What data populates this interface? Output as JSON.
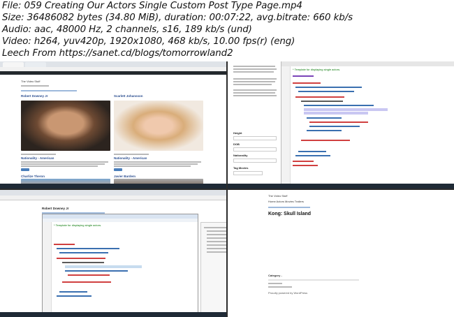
{
  "header": {
    "lines": [
      "File: 059 Creating Our Actors Single Custom Post Type Page.mp4",
      "Size: 36486082 bytes (34.80 MiB), duration: 00:07:22, avg.bitrate: 660 kb/s",
      "Audio: aac, 48000 Hz, 2 channels, s16, 189 kb/s (und)",
      "Video: h264, yuv420p, 1920x1080, 468 kb/s, 10.00 fps(r) (eng)",
      "Leech From https://sanet.cd/blogs/tomorrowland2"
    ]
  },
  "thumb1": {
    "actors": [
      "Robert Downey Jr",
      "Scarlett Johansson",
      "Charlize Theron",
      "Javier Bardem"
    ],
    "field_label": "Nationality - American"
  },
  "thumb2": {
    "labels": [
      "Height",
      "DOB",
      "Nationality",
      "Tag Movies"
    ],
    "code_comment": "* Template for displaying single actors."
  },
  "thumb3": {
    "heading": "Robert Downey Jr",
    "code_comment": "* Template for displaying single actors."
  },
  "thumb4": {
    "site_title": "The Video Stuff",
    "nav": "Home  Actors  Movies  Trailers",
    "post_title": "Kong: Skull Island",
    "category_label": "Category -",
    "footer": "Proudly powered by WordPress"
  },
  "colors": {
    "editor_highlight": "#c9c7f2",
    "link_blue": "#2a6ebb",
    "wp_adminbar": "#23282d"
  }
}
